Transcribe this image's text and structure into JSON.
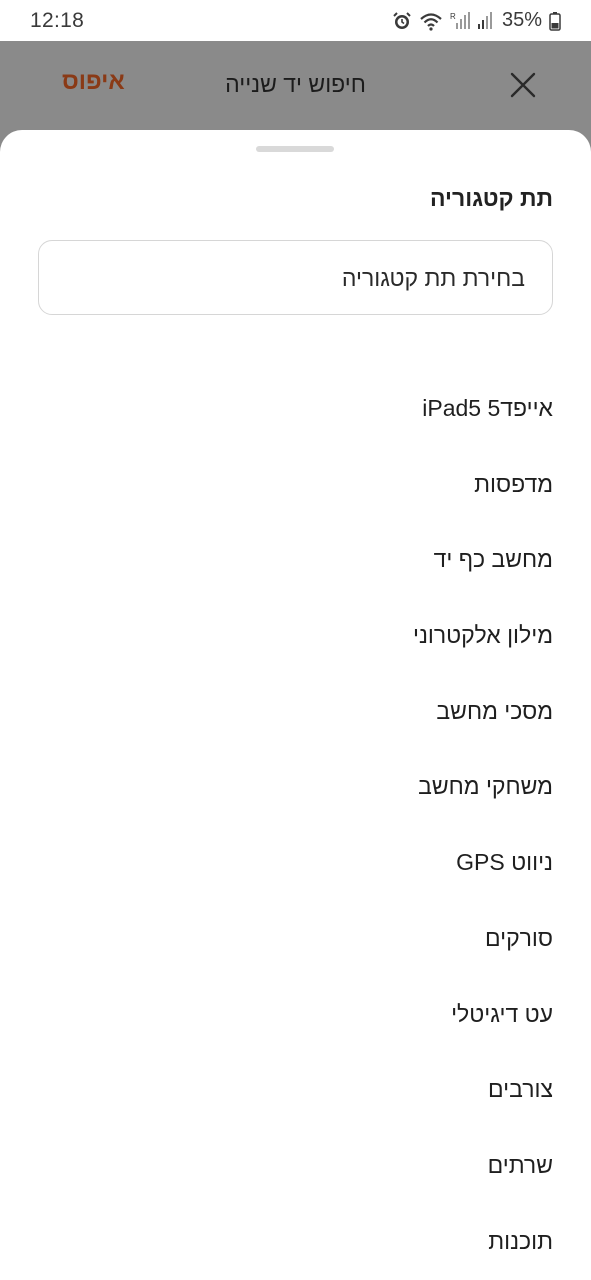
{
  "status_bar": {
    "time": "12:18",
    "battery": "35%",
    "icons": [
      "alarm-icon",
      "wifi-icon",
      "signal-r-icon",
      "signal-icon",
      "battery-icon"
    ]
  },
  "header": {
    "title": "חיפוש יד שנייה",
    "reset_label": "איפוס",
    "close_icon": "close-icon",
    "reset_color": "#8a3a16"
  },
  "sheet": {
    "section_title": "תת קטגוריה",
    "select_placeholder": "בחירת תת קטגוריה",
    "options": [
      "אייפד5 iPad5",
      "מדפסות",
      "מחשב כף יד",
      "מילון אלקטרוני",
      "מסכי מחשב",
      "משחקי מחשב",
      "ניווט GPS",
      "סורקים",
      "עט דיגיטלי",
      "צורבים",
      "שרתים",
      "תוכנות"
    ]
  }
}
